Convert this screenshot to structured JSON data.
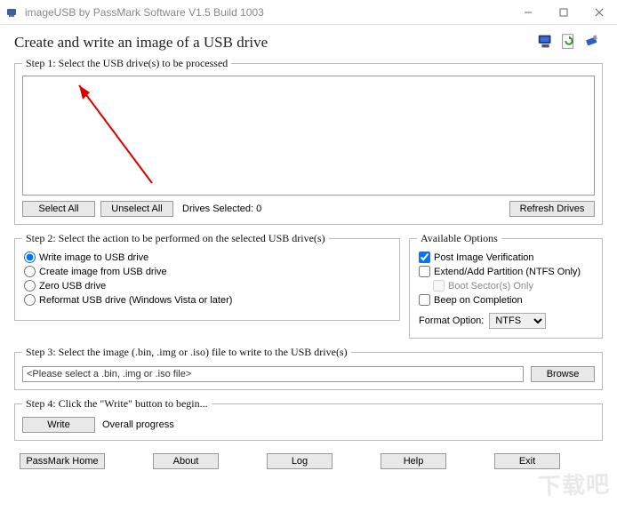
{
  "window": {
    "title": "imageUSB by PassMark Software V1.5 Build 1003"
  },
  "header": {
    "title": "Create and write an image of a USB drive"
  },
  "step1": {
    "legend": "Step 1:  Select the USB drive(s) to be processed",
    "select_all": "Select All",
    "unselect_all": "Unselect All",
    "drives_selected": "Drives Selected: 0",
    "refresh": "Refresh Drives"
  },
  "step2": {
    "legend": "Step 2: Select the action to be performed on the selected USB drive(s)",
    "opt_write": "Write image to USB drive",
    "opt_create": "Create image from USB drive",
    "opt_zero": "Zero USB drive",
    "opt_reformat": "Reformat USB drive (Windows Vista or later)"
  },
  "options": {
    "legend": "Available Options",
    "post_verify": "Post Image Verification",
    "extend": "Extend/Add Partition (NTFS Only)",
    "boot_sector": "Boot Sector(s) Only",
    "beep": "Beep on Completion",
    "format_label": "Format Option:",
    "format_value": "NTFS"
  },
  "step3": {
    "legend": "Step 3: Select the image (.bin, .img or .iso) file to write to the USB drive(s)",
    "placeholder": "<Please select a .bin, .img or .iso file>",
    "browse": "Browse"
  },
  "step4": {
    "legend": "Step 4: Click the \"Write\" button to begin...",
    "write": "Write",
    "progress_label": "Overall progress"
  },
  "footer": {
    "home": "PassMark Home",
    "about": "About",
    "log": "Log",
    "help": "Help",
    "exit": "Exit"
  }
}
